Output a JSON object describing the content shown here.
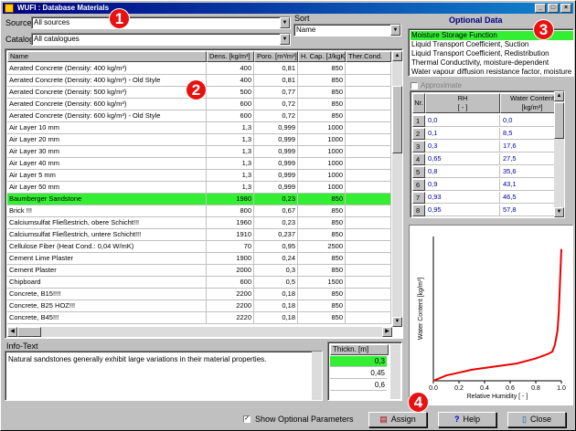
{
  "window": {
    "title": "WUFI : Database Materials",
    "min": "_",
    "max": "□",
    "close": "×"
  },
  "source": {
    "label": "Source",
    "value": "All sources"
  },
  "catalog": {
    "label": "Catalog",
    "value": "All catalogues"
  },
  "sort": {
    "label": "Sort",
    "value": "Name"
  },
  "materials": {
    "columns": [
      "Name",
      "Dens. [kg/m³]",
      "Poro. [m³/m³]",
      "H. Cap. [J/kgK]",
      "Ther.Cond."
    ],
    "rows": [
      [
        "Aerated Concrete (Density: 400 kg/m³)",
        "400",
        "0,81",
        "850",
        ""
      ],
      [
        "Aerated Concrete (Density: 400 kg/m³) - Old Style",
        "400",
        "0,81",
        "850",
        ""
      ],
      [
        "Aerated Concrete (Density: 500 kg/m³)",
        "500",
        "0,77",
        "850",
        ""
      ],
      [
        "Aerated Concrete (Density: 600 kg/m³)",
        "600",
        "0,72",
        "850",
        ""
      ],
      [
        "Aerated Concrete (Density: 600 kg/m³) - Old Style",
        "600",
        "0,72",
        "850",
        ""
      ],
      [
        "Air Layer 10 mm",
        "1,3",
        "0,999",
        "1000",
        ""
      ],
      [
        "Air Layer 20 mm",
        "1,3",
        "0,999",
        "1000",
        ""
      ],
      [
        "Air Layer 30 mm",
        "1,3",
        "0,999",
        "1000",
        ""
      ],
      [
        "Air Layer 40 mm",
        "1,3",
        "0,999",
        "1000",
        ""
      ],
      [
        "Air Layer 5 mm",
        "1,3",
        "0,999",
        "1000",
        ""
      ],
      [
        "Air Layer 50 mm",
        "1,3",
        "0,999",
        "1000",
        ""
      ],
      [
        "Baumberger Sandstone",
        "1980",
        "0,23",
        "850",
        ""
      ],
      [
        "Brick !!!",
        "800",
        "0,67",
        "850",
        ""
      ],
      [
        "Calciumsulfat Fließestrich, obere Schicht!!!",
        "1960",
        "0,23",
        "850",
        ""
      ],
      [
        "Calciumsulfat Fließestrich, untere Schicht!!!",
        "1910",
        "0,237",
        "850",
        ""
      ],
      [
        "Cellulose Fiber (Heat Cond.: 0,04 W/mK)",
        "70",
        "0,95",
        "2500",
        ""
      ],
      [
        "Cement Lime Plaster",
        "1900",
        "0,24",
        "850",
        ""
      ],
      [
        "Cement Plaster",
        "2000",
        "0,3",
        "850",
        ""
      ],
      [
        "Chipboard",
        "600",
        "0,5",
        "1500",
        ""
      ],
      [
        "Concrete, B15!!!!",
        "2200",
        "0,18",
        "850",
        ""
      ],
      [
        "Concrete, B25 HOZ!!!",
        "2200",
        "0,18",
        "850",
        ""
      ],
      [
        "Concrete, B45!!!",
        "2220",
        "0,18",
        "850",
        ""
      ]
    ],
    "selected_index": 11
  },
  "info": {
    "label": "Info-Text",
    "text": "Natural sandstones generally exhibit large variations in their material properties."
  },
  "thickness": {
    "header": "Thickn. [m]",
    "values": [
      "0,3",
      "0,45",
      "0,6"
    ],
    "selected_index": 0
  },
  "optional": {
    "title": "Optional Data",
    "items": [
      "Moisture Storage Function",
      "Liquid Transport Coefficient, Suction",
      "Liquid Transport Coefficient, Redistribution",
      "Thermal Conductivity, moisture-dependent",
      "Water vapour diffusion resistance factor, moisture"
    ],
    "selected_index": 0,
    "approximate_label": "Approximate"
  },
  "rh_table": {
    "col_nr": "Nr.",
    "col_rh": "RH",
    "col_rh_unit": "[ - ]",
    "col_wc": "Water Content",
    "col_wc_unit": "[kg/m³]",
    "rows": [
      [
        "1",
        "0,0",
        "0,0"
      ],
      [
        "2",
        "0,1",
        "8,5"
      ],
      [
        "3",
        "0,3",
        "17,6"
      ],
      [
        "4",
        "0,65",
        "27,5"
      ],
      [
        "5",
        "0,8",
        "35,6"
      ],
      [
        "6",
        "0,9",
        "43,1"
      ],
      [
        "7",
        "0,93",
        "46,5"
      ],
      [
        "8",
        "0,95",
        "57,8"
      ]
    ]
  },
  "chart_data": {
    "type": "line",
    "xlabel": "Relative Humidity [ - ]",
    "ylabel": "Water Content [kg/m³]",
    "xlim": [
      0,
      1
    ],
    "xticks": [
      "0.0",
      "0.2",
      "0.4",
      "0.6",
      "0.8",
      "1.0"
    ],
    "grid": false,
    "series": [
      {
        "color": "#ee0000",
        "x": [
          0.0,
          0.1,
          0.3,
          0.65,
          0.8,
          0.9,
          0.93,
          0.95,
          0.97,
          0.98,
          0.99,
          1.0
        ],
        "y": [
          0.0,
          8.5,
          17.6,
          27.5,
          35.6,
          43.1,
          46.5,
          57.8,
          80,
          110,
          160,
          210
        ]
      }
    ],
    "ylim": [
      0,
      230
    ]
  },
  "bottom": {
    "show_optional": "Show Optional Parameters",
    "assign": "Assign",
    "help": "Help",
    "close": "Close"
  },
  "markers": [
    "1",
    "2",
    "3",
    "4"
  ],
  "colors": {
    "selection": "#33ee33",
    "titlebar": "#000080",
    "marker": "#e81010",
    "curve": "#ee0000"
  }
}
